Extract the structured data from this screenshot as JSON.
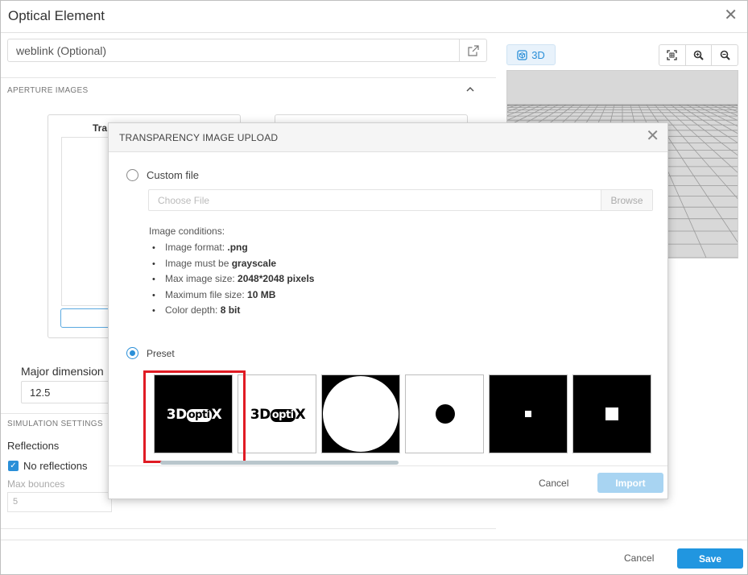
{
  "window": {
    "title": "Optical Element",
    "weblink_placeholder": "weblink (Optional)",
    "aperture_section": "APERTURE IMAGES",
    "card_left_title": "Tra",
    "major_dimension_label": "Major dimension",
    "major_dimension_value": "12.5",
    "simulation_section": "SIMULATION SETTINGS",
    "reflections_label": "Reflections",
    "no_reflections_label": "No reflections",
    "no_reflections_checked": true,
    "max_bounces_label": "Max bounces",
    "max_bounces_value": "5",
    "cancel_label": "Cancel",
    "save_label": "Save",
    "view3d_label": "3D"
  },
  "modal": {
    "title": "TRANSPARENCY IMAGE UPLOAD",
    "custom_file_label": "Custom file",
    "custom_file_selected": false,
    "choose_file_placeholder": "Choose File",
    "browse_label": "Browse",
    "conditions_title": "Image conditions:",
    "conditions": [
      {
        "label": "Image format: ",
        "value": ".png"
      },
      {
        "label": "Image must be ",
        "value": "grayscale"
      },
      {
        "label": "Max image size: ",
        "value": "2048*2048 pixels"
      },
      {
        "label": "Maximum file size: ",
        "value": "10 MB"
      },
      {
        "label": "Color depth: ",
        "value": "8 bit"
      }
    ],
    "preset_label": "Preset",
    "preset_selected": true,
    "logo_text": {
      "prefix": "3D",
      "pill": "opti",
      "suffix": "X"
    },
    "presets": [
      "logo-black",
      "logo-white",
      "large-circle",
      "small-dot",
      "tiny-square",
      "small-square"
    ],
    "selected_preset_index": 0,
    "cancel_label": "Cancel",
    "import_label": "Import"
  },
  "colors": {
    "accent": "#2196e0",
    "selection": "#e01b24",
    "import_disabled": "#a8d4f2"
  },
  "icons": {
    "close": "close-icon",
    "external_link": "external-link-icon",
    "chevron_up": "chevron-up-icon",
    "cube": "cube-icon",
    "fit_view": "fit-view-icon",
    "zoom_in": "zoom-in-icon",
    "zoom_out": "zoom-out-icon"
  }
}
